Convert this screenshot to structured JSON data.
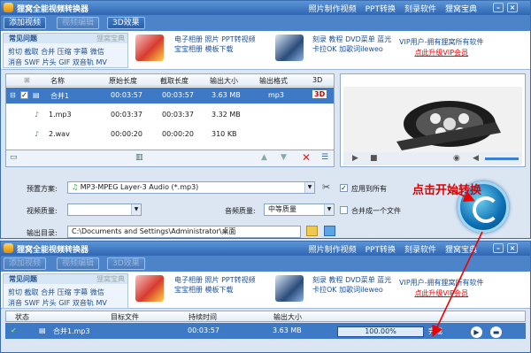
{
  "app": {
    "title": "狸窝全能视频转换器",
    "title_links": [
      "照片制作视频",
      "PPT转换",
      "刻录软件",
      "狸窝宝典"
    ]
  },
  "toolbar": {
    "add_video": "添加视频",
    "edit_video": "视频编辑",
    "effect_3d": "3D效果"
  },
  "faq": {
    "title": "常见问题",
    "badge": "狸窝宝典",
    "line1": "剪切 截取 合并 压缩 字幕 微信",
    "line2": "消音 SWF 片头 GIF 双音轨 MV"
  },
  "ads": {
    "ad1_line1": "电子相册 照片 PPT转视频",
    "ad1_line2": "宝宝相册 模板下载",
    "ad2_line1": "刻录 教程 DVD菜单 蓝光",
    "ad2_line2": "卡拉OK 加歌词ileweo",
    "vip_line1": "VIP用户-拥有狸窝所有软件",
    "vip_link": "点此升级VIP会员"
  },
  "filelist": {
    "headers": {
      "name": "名称",
      "orig_len": "原始长度",
      "cut_len": "截取长度",
      "out_size": "输出大小",
      "out_fmt": "输出格式",
      "col_3d": "3D"
    },
    "rows": [
      {
        "name": "合并1",
        "orig": "00:03:57",
        "cut": "00:03:57",
        "size": "3.63 MB",
        "fmt": "mp3",
        "badge": "3D"
      },
      {
        "name": "1.mp3",
        "orig": "00:03:37",
        "cut": "00:03:37",
        "size": "3.32 MB",
        "fmt": "",
        "badge": ""
      },
      {
        "name": "2.wav",
        "orig": "00:00:20",
        "cut": "00:00:20",
        "size": "310 KB",
        "fmt": "",
        "badge": ""
      }
    ]
  },
  "form": {
    "preset_label": "预置方案:",
    "preset_value": "MP3-MPEG Layer-3 Audio (*.mp3)",
    "apply_all": "应用到所有",
    "video_quality_label": "视频质量:",
    "audio_quality_label": "音频质量:",
    "audio_quality_value": "中等质量",
    "merge_label": "合并成一个文件",
    "output_label": "输出目录:",
    "output_value": "C:\\Documents and Settings\\Administrator\\桌面"
  },
  "annotation": "点击开始转换",
  "task": {
    "headers": {
      "status": "状态",
      "target": "目标文件",
      "duration": "持续时间",
      "size": "输出大小"
    },
    "row": {
      "file": "合并1.mp3",
      "duration": "00:03:57",
      "size": "3.63 MB",
      "progress": "100.00%",
      "status": "完成"
    }
  }
}
